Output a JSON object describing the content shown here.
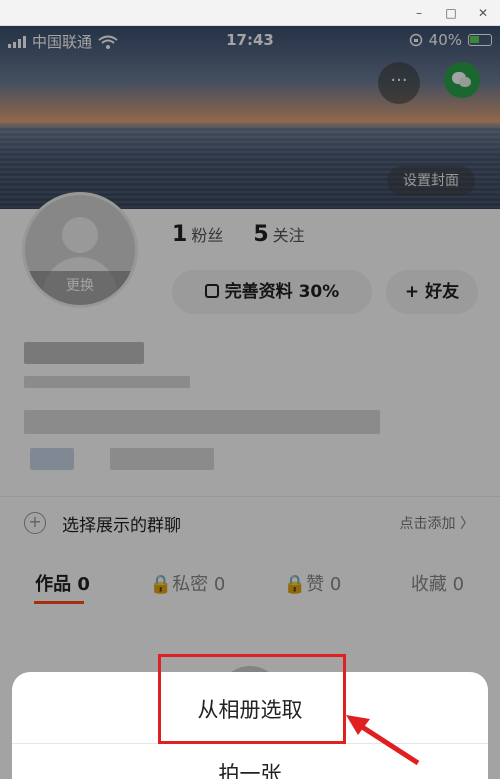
{
  "window": {
    "minimize": "–",
    "maximize": "□",
    "close": "✕"
  },
  "statusbar": {
    "carrier": "中国联通",
    "time": "17:43",
    "battery": "40%"
  },
  "cover": {
    "more_icon": "···",
    "set_cover": "设置封面"
  },
  "profile": {
    "avatar_change": "更换",
    "followers_count": "1",
    "followers_label": "粉丝",
    "following_count": "5",
    "following_label": "关注",
    "complete_profile": "完善资料 30%",
    "add_friend": "+ 好友"
  },
  "group": {
    "label": "选择展示的群聊",
    "action": "点击添加 〉"
  },
  "tabs": [
    {
      "label": "作品 0"
    },
    {
      "label": "🔒私密 0"
    },
    {
      "label": "🔒赞 0"
    },
    {
      "label": "收藏 0"
    }
  ],
  "sheet": {
    "choose_album": "从相册选取",
    "take_photo": "拍一张"
  },
  "colors": {
    "accent": "#ff4a1a",
    "annotation": "#e02020"
  }
}
